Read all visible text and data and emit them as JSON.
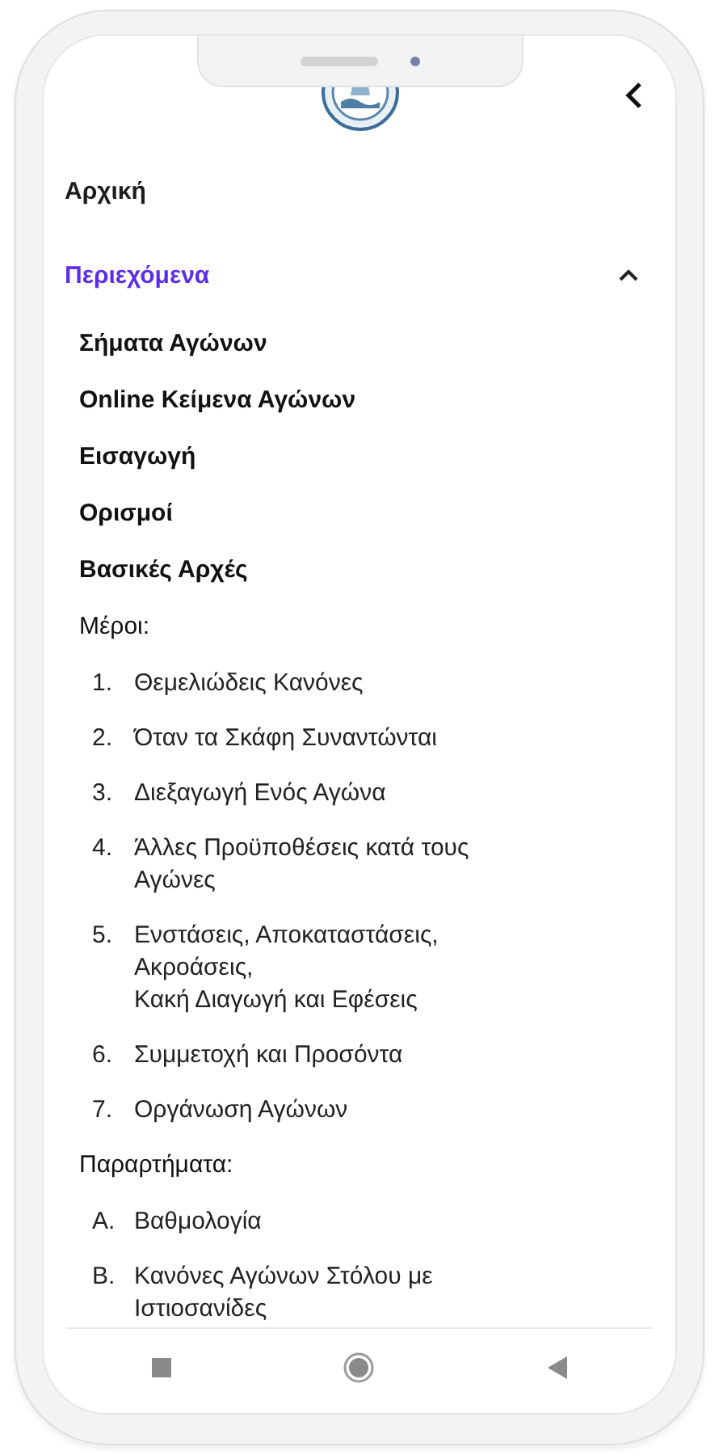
{
  "menu": [
    {
      "kind": "link",
      "label": "Αρχική",
      "selected": false
    },
    {
      "kind": "section",
      "label": "Περιεχόμενα",
      "selected": true,
      "expanded": true,
      "children": [
        {
          "kind": "link",
          "label": "Σήματα Αγώνων"
        },
        {
          "kind": "link",
          "label": "Online Κείμενα Αγώνων"
        },
        {
          "kind": "link",
          "label": "Εισαγωγή"
        },
        {
          "kind": "link",
          "label": "Ορισμοί"
        },
        {
          "kind": "link",
          "label": "Βασικές Αρχές"
        },
        {
          "kind": "heading",
          "label": "Μέροι:",
          "children": [
            {
              "marker": "1.",
              "lines": [
                "Θεμελιώδεις Κανόνες"
              ]
            },
            {
              "marker": "2.",
              "lines": [
                "Όταν τα Σκάφη Συναντώνται"
              ]
            },
            {
              "marker": "3.",
              "lines": [
                "Διεξαγωγή Ενός Αγώνα"
              ]
            },
            {
              "marker": "4.",
              "lines": [
                "Άλλες Προϋποθέσεις κατά τους",
                "Αγώνες"
              ]
            },
            {
              "marker": "5.",
              "lines": [
                "Ενστάσεις, Αποκαταστάσεις,",
                "Ακροάσεις,",
                "Κακή Διαγωγή και Εφέσεις"
              ]
            },
            {
              "marker": "6.",
              "lines": [
                "Συμμετοχή και Προσόντα"
              ]
            },
            {
              "marker": "7.",
              "lines": [
                "Οργάνωση Αγώνων"
              ]
            }
          ]
        },
        {
          "kind": "heading",
          "label": "Παραρτήματα:",
          "children": [
            {
              "marker": "A.",
              "lines": [
                "Βαθμολογία"
              ]
            },
            {
              "marker": "B.",
              "lines": [
                "Κανόνες Αγώνων Στόλου με",
                "Ιστιοσανίδες"
              ]
            }
          ]
        }
      ]
    }
  ]
}
